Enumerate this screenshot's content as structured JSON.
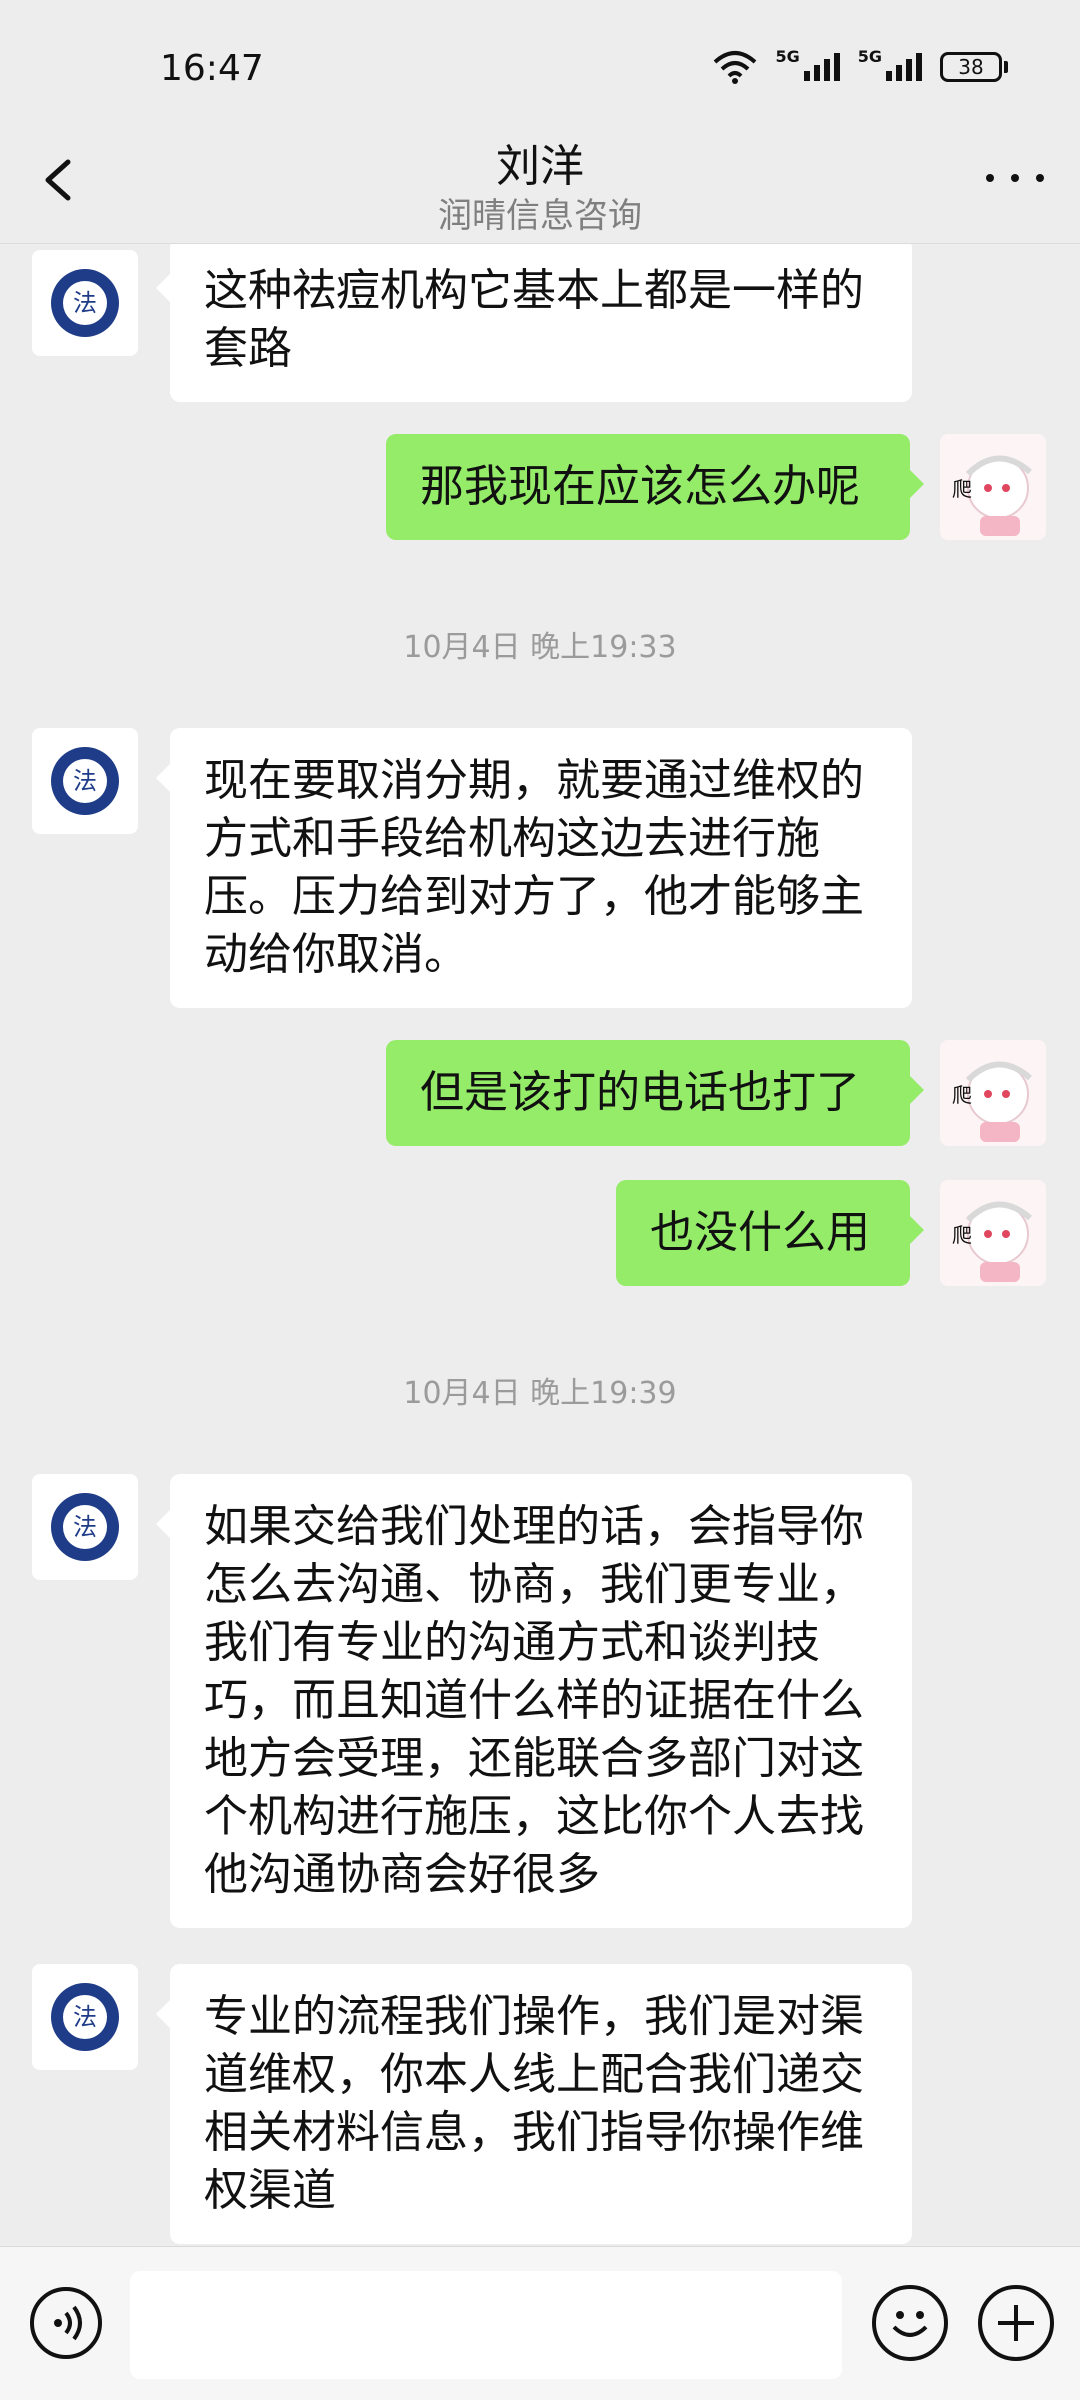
{
  "status_bar": {
    "time": "16:47",
    "signal_1_label": "5G",
    "signal_2_label": "5G",
    "battery": "38"
  },
  "header": {
    "title": "刘洋",
    "subtitle": "润晴信息咨询"
  },
  "messages": [
    {
      "sender": "agent",
      "text": "这种祛痘机构它基本上都是一样的套路"
    },
    {
      "sender": "user",
      "text": "那我现在应该怎么办呢"
    },
    {
      "timestamp": "10月4日 晚上19:33"
    },
    {
      "sender": "agent",
      "text": "现在要取消分期，就要通过维权的方式和手段给机构这边去进行施压。压力给到对方了，他才能够主动给你取消。"
    },
    {
      "sender": "user",
      "text": "但是该打的电话也打了"
    },
    {
      "sender": "user",
      "text": "也没什么用"
    },
    {
      "timestamp": "10月4日 晚上19:39"
    },
    {
      "sender": "agent",
      "text": "如果交给我们处理的话，会指导你怎么去沟通、协商，我们更专业，我们有专业的沟通方式和谈判技巧，而且知道什么样的证据在什么地方会受理，还能联合多部门对这个机构进行施压，这比你个人去找他沟通协商会好很多"
    },
    {
      "sender": "agent",
      "text": "专业的流程我们操作，我们是对渠道维权，你本人线上配合我们递交相关材料信息，我们指导你操作维权渠道"
    }
  ],
  "avatars": {
    "agent_logo_char": "法",
    "user_sticker_char": "爬"
  },
  "colors": {
    "background": "#ededed",
    "bubble_self": "#95ec69",
    "bubble_other": "#ffffff",
    "logo_blue": "#1f3c88"
  },
  "icons": {
    "back": "chevron-left-icon",
    "more": "more-dots-icon",
    "voice": "voice-icon",
    "emoji": "emoji-icon",
    "plus": "plus-icon"
  }
}
